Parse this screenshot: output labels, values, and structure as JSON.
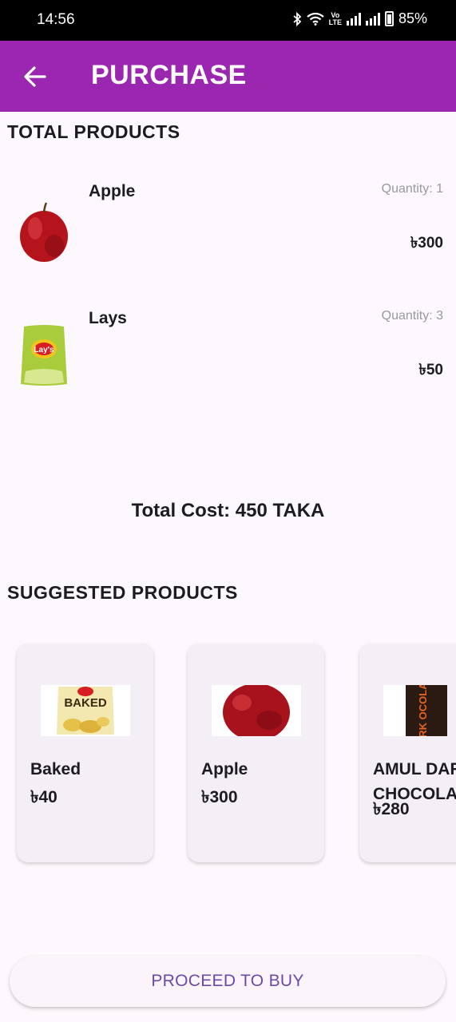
{
  "status_bar": {
    "time": "14:56",
    "volte_line1": "Vo",
    "volte_line2": "LTE",
    "battery": "85%"
  },
  "app_bar": {
    "back_icon": "arrow-left-icon",
    "title": "PURCHASE"
  },
  "total_products": {
    "heading": "TOTAL PRODUCTS",
    "items": [
      {
        "name": "Apple",
        "quantity": "Quantity: 1",
        "price": "৳300",
        "image": "apple"
      },
      {
        "name": "Lays",
        "quantity": "Quantity: 3",
        "price": "৳50",
        "image": "lays-chips"
      }
    ]
  },
  "total_cost": "Total Cost: 450 TAKA",
  "suggested_products": {
    "heading": "SUGGESTED PRODUCTS",
    "items": [
      {
        "name": "Baked",
        "price": "৳40",
        "image": "baked-chips",
        "image_text": "BAKED"
      },
      {
        "name": "Apple",
        "price": "৳300",
        "image": "apple"
      },
      {
        "name_line1": "AMUL DAR",
        "name_line2": "CHOCOLA",
        "price": "৳280",
        "image": "dark-chocolate",
        "image_text": "ARK OCOLATE"
      }
    ]
  },
  "proceed_button": "PROCEED TO BUY",
  "colors": {
    "app_bar": "#9b27b0",
    "background": "#fdf8fd",
    "card": "#f4eef6",
    "button_text": "#6a4aa6"
  }
}
